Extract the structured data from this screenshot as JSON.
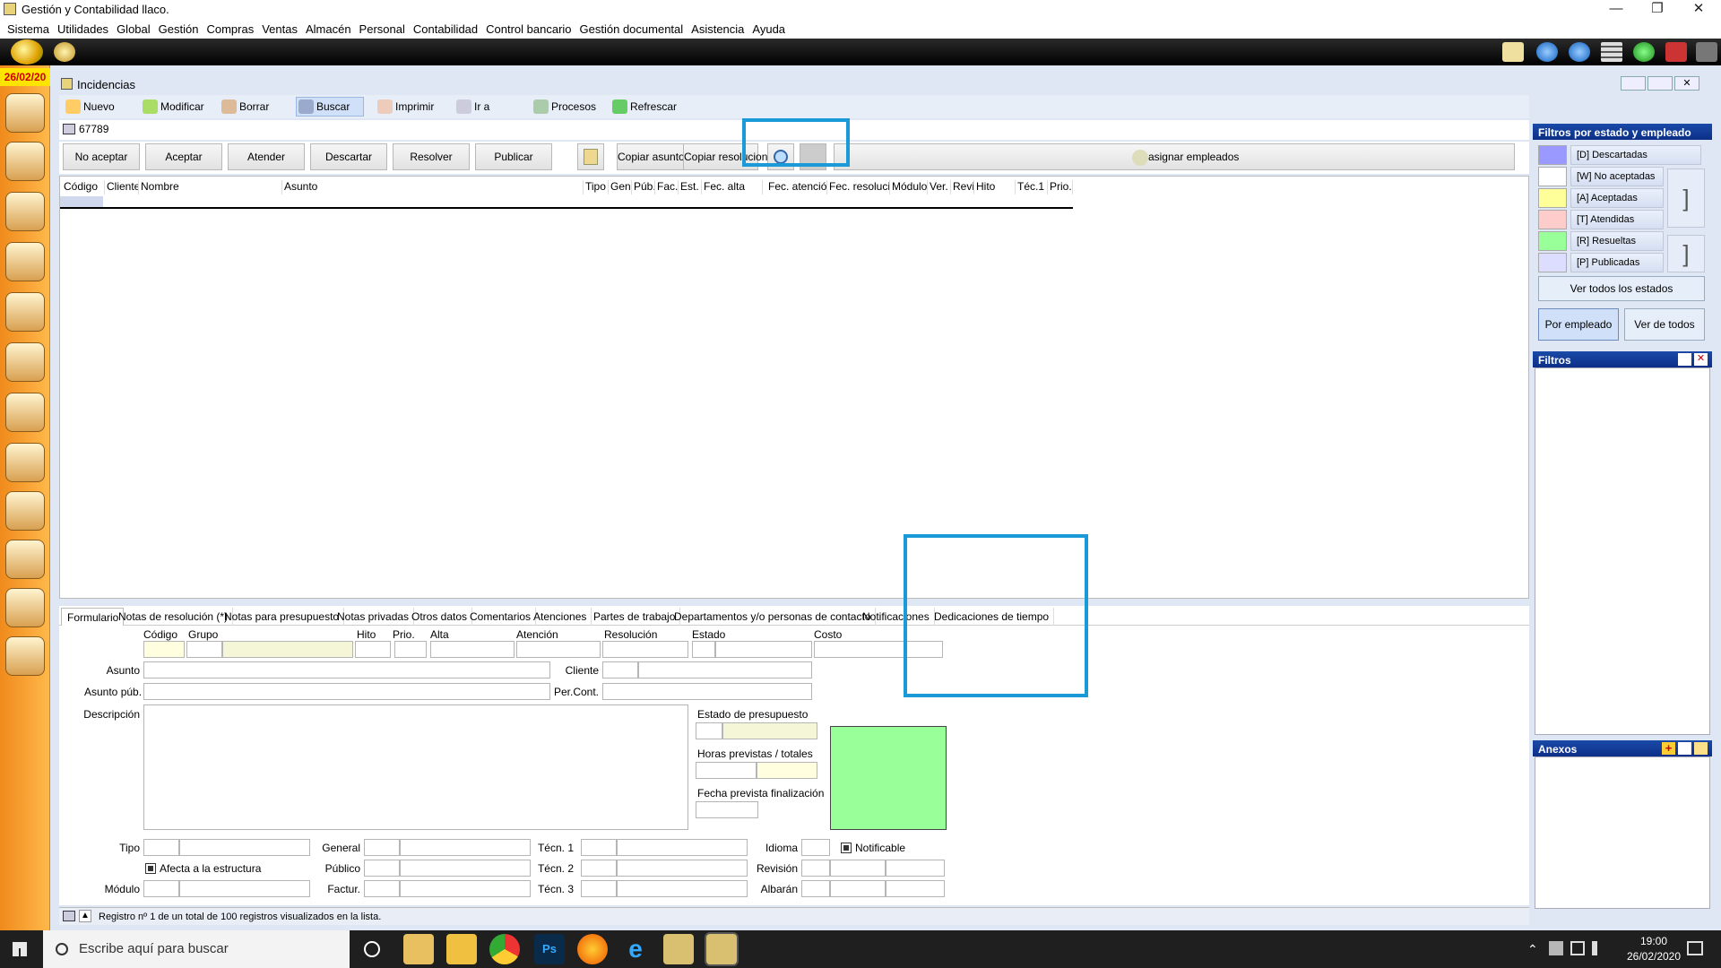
{
  "window": {
    "title": "Gestión y Contabilidad llaco."
  },
  "menu": [
    "Sistema",
    "Utilidades",
    "Global",
    "Gestión",
    "Compras",
    "Ventas",
    "Almacén",
    "Personal",
    "Contabilidad",
    "Control bancario",
    "Gestión documental",
    "Asistencia",
    "Ayuda"
  ],
  "sidebar": {
    "date": "26/02/20"
  },
  "incidencias": {
    "title": "Incidencias"
  },
  "toolbar": {
    "nuevo": "Nuevo",
    "modificar": "Modificar",
    "borrar": "Borrar",
    "buscar": "Buscar",
    "imprimir": "Imprimir",
    "ir_a": "Ir a",
    "procesos": "Procesos",
    "refrescar": "Refrescar"
  },
  "search": {
    "value": "67789"
  },
  "actions": {
    "no_aceptar": "No aceptar",
    "aceptar": "Aceptar",
    "atender": "Atender",
    "descartar": "Descartar",
    "resolver": "Resolver",
    "publicar": "Publicar",
    "copiar_asunto": "Copiar asunto",
    "copiar_resolucion": "Copiar resolucion",
    "reasignar": "Reasignar empleados"
  },
  "grid": {
    "columns": [
      "Código",
      "Cliente",
      "Nombre",
      "Asunto",
      "Tipo",
      "Gen.",
      "Púb.",
      "Fac.",
      "Est.",
      "Fec. alta",
      "Fec. atención",
      "Fec. resolució",
      "Módulo",
      "Ver.",
      "Revi",
      "Hito",
      "Téc.1",
      "Prio."
    ]
  },
  "filters": {
    "title": "Filtros por estado y empleado",
    "items": [
      {
        "label": "[D] Descartadas",
        "color": "#9999ff"
      },
      {
        "label": "[W] No aceptadas",
        "color": "#ffffff"
      },
      {
        "label": "[A] Aceptadas",
        "color": "#ffff99"
      },
      {
        "label": "[T] Atendidas",
        "color": "#ffcccc"
      },
      {
        "label": "[R] Resueltas",
        "color": "#99ff99"
      },
      {
        "label": "[P] Publicadas",
        "color": "#ddddff"
      }
    ],
    "ver_todos_estados": "Ver todos los estados",
    "por_empleado": "Por empleado",
    "ver_de_todos": "Ver de todos",
    "filtros_title": "Filtros",
    "anexos_title": "Anexos"
  },
  "tabs": [
    "Formulario",
    "Notas de resolución (*)",
    "Notas para presupuesto",
    "Notas privadas",
    "Otros datos",
    "Comentarios",
    "Atenciones",
    "Partes de trabajo",
    "Departamentos y/o personas de contacto",
    "Notificaciones",
    "Dedicaciones de tiempo"
  ],
  "form": {
    "codigo": "Código",
    "grupo": "Grupo",
    "hito": "Hito",
    "prio": "Prio.",
    "alta": "Alta",
    "atencion": "Atención",
    "resolucion": "Resolución",
    "estado": "Estado",
    "costo": "Costo",
    "asunto": "Asunto",
    "cliente": "Cliente",
    "asunto_pub": "Asunto púb.",
    "per_cont": "Per.Cont.",
    "descripcion": "Descripción",
    "estado_presupuesto": "Estado de presupuesto",
    "horas": "Horas previstas / totales",
    "fecha_fin": "Fecha prevista finalización",
    "tipo": "Tipo",
    "general": "General",
    "tecn1": "Técn. 1",
    "idioma": "Idioma",
    "notificable": "Notificable",
    "afecta": "Afecta a la estructura",
    "publico": "Público",
    "tecn2": "Técn. 2",
    "revision": "Revisión",
    "modulo": "Módulo",
    "factur": "Factur.",
    "tecn3": "Técn. 3",
    "albaran": "Albarán",
    "green_color": "#99ff99"
  },
  "status": {
    "text": "Registro nº 1 de un total de 100 registros visualizados en la lista."
  },
  "taskbar": {
    "search": "Escribe aquí para buscar",
    "time": "19:00",
    "date": "26/02/2020"
  }
}
